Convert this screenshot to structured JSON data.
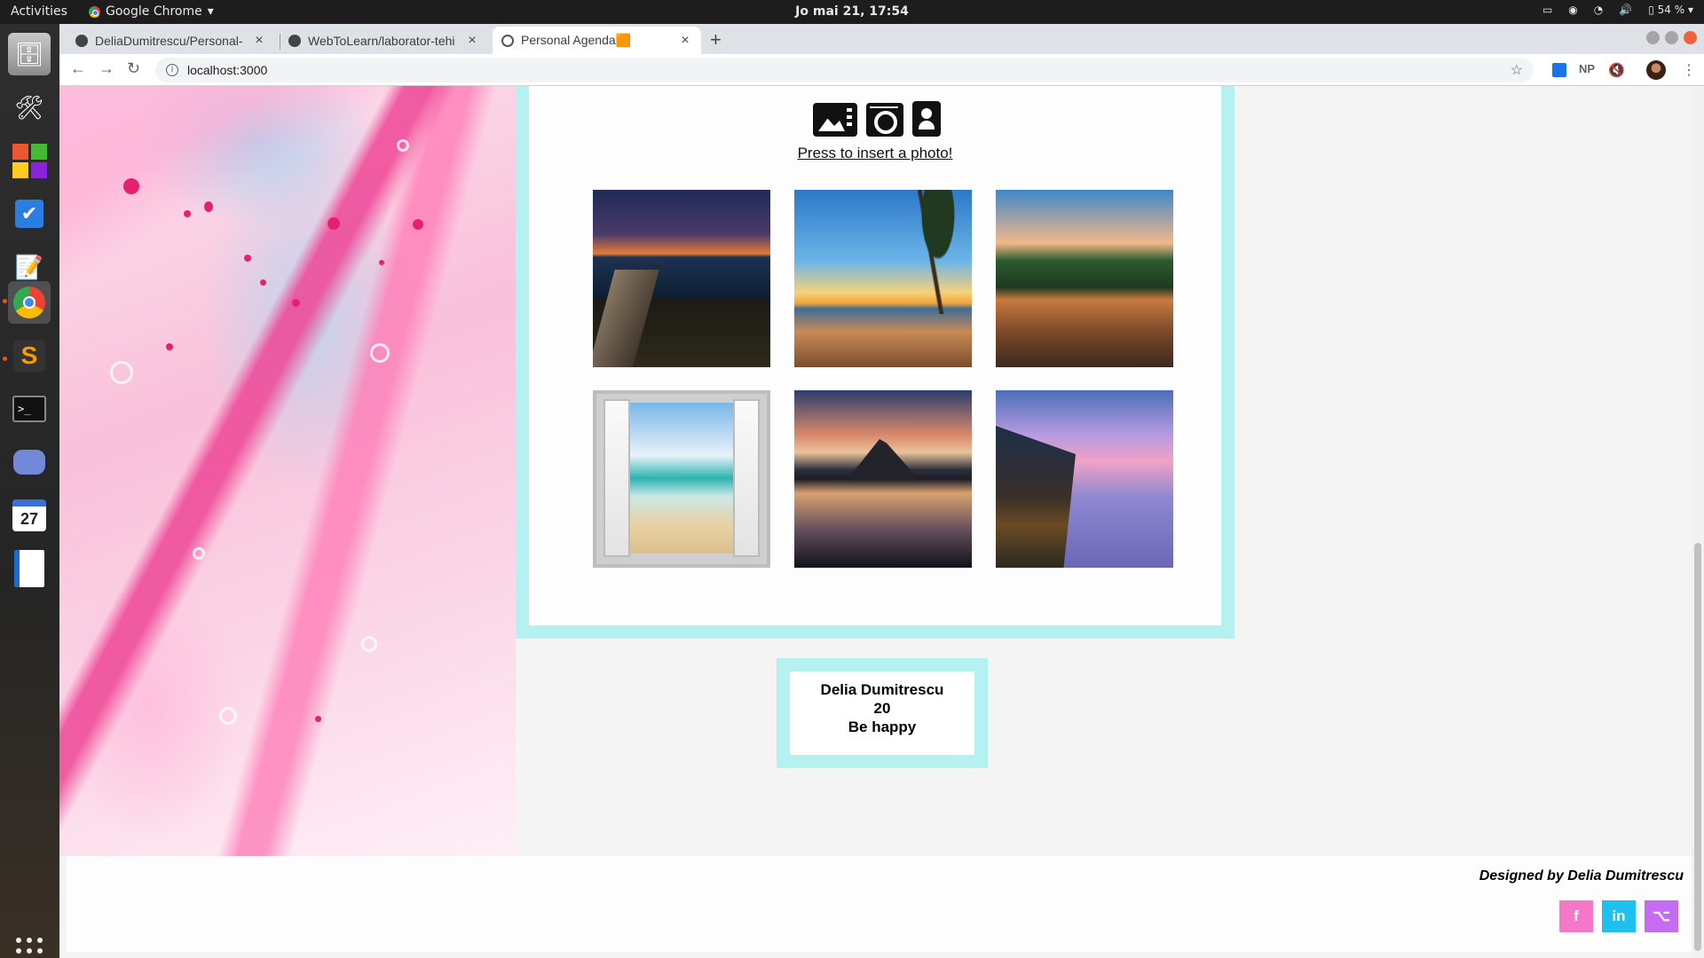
{
  "topbar": {
    "activities": "Activities",
    "app_name": "Google Chrome",
    "clock": "Jo mai 21, 17:54",
    "battery": "54 %"
  },
  "browser": {
    "tabs": [
      {
        "title": "DeliaDumitrescu/Personal-",
        "close": "×"
      },
      {
        "title": "WebToLearn/laborator-tehi",
        "close": "×"
      },
      {
        "title": "Personal Agenda🟧",
        "close": "×"
      }
    ],
    "new_tab": "+",
    "url": "localhost:3000",
    "extensions": [
      "NP"
    ]
  },
  "page": {
    "insert_photo_link": "Press to insert a photo!",
    "photos": [
      {
        "alt": "pier sunset"
      },
      {
        "alt": "palm beach sunset"
      },
      {
        "alt": "tropical cove"
      },
      {
        "alt": "beach window"
      },
      {
        "alt": "mountain reflection"
      },
      {
        "alt": "cliff resort"
      }
    ],
    "profile": {
      "name": "Delia Dumitrescu",
      "age": "20",
      "motto": "Be happy"
    },
    "footer": {
      "credit": "Designed by Delia Dumitrescu",
      "social": [
        {
          "label": "f",
          "name": "facebook",
          "color": "#f578c8"
        },
        {
          "label": "in",
          "name": "linkedin",
          "color": "#1ec1ee"
        },
        {
          "label": "⌥",
          "name": "github",
          "color": "#c66cf2"
        }
      ]
    }
  },
  "colors": {
    "card_border": "#b5f1f0",
    "marble_pink": "#e6206f"
  }
}
